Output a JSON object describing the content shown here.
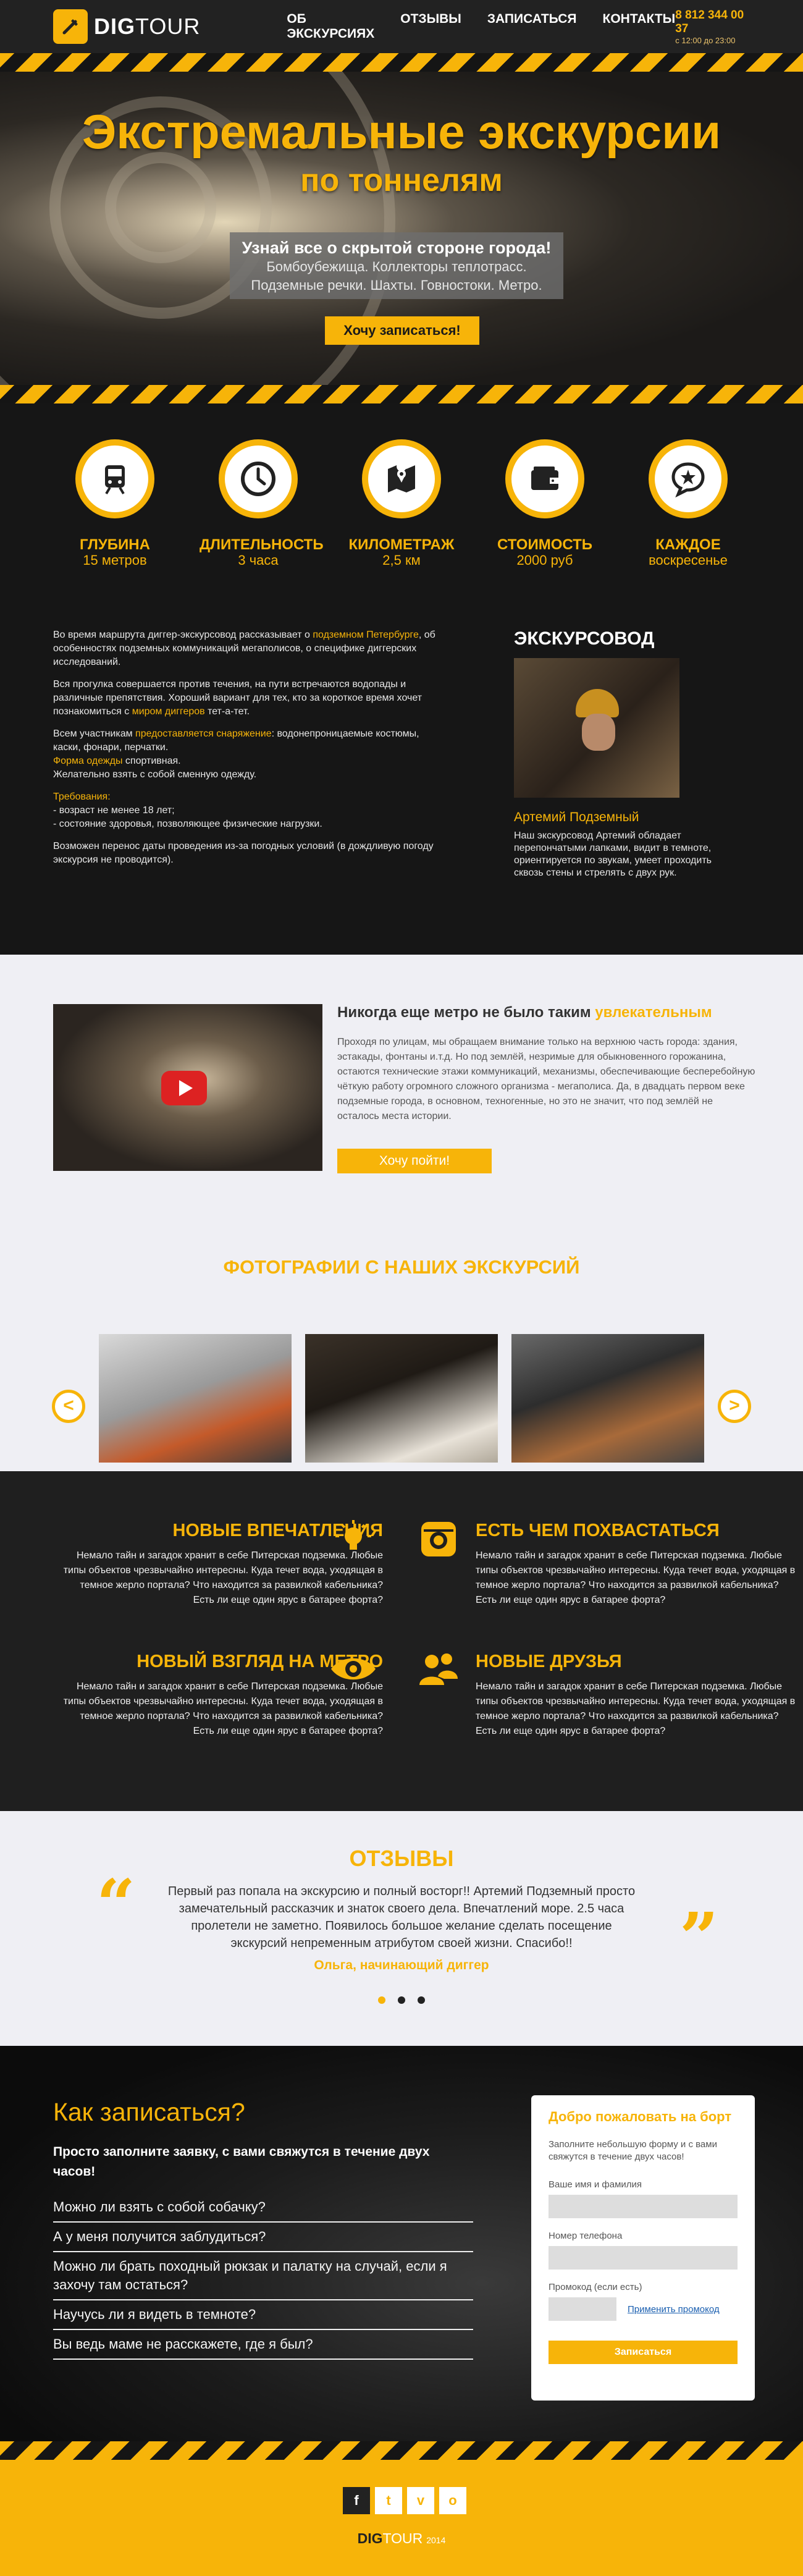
{
  "brand": {
    "logo_word_dig": "DIG",
    "logo_word_tour": "TOUR",
    "accent": "#f7b409"
  },
  "nav": [
    "ОБ ЭКСКУРСИЯХ",
    "ОТЗЫВЫ",
    "ЗАПИСАТЬСЯ",
    "КОНТАКТЫ"
  ],
  "contact": {
    "phone": "8 812 344 00 37",
    "hours": "с 12:00 до 23:00"
  },
  "hero": {
    "title": "Экстремальные экскурсии",
    "subtitle": "по тоннелям",
    "lead": "Узнай все о скрытой стороне города!",
    "line1": "Бомбоубежища. Коллекторы теплотрасс.",
    "line2": "Подземные речки. Шахты. Говностоки. Метро.",
    "cta": "Хочу записаться!"
  },
  "stats": [
    {
      "icon": "metro-icon",
      "title": "ГЛУБИНА",
      "value": "15 метров"
    },
    {
      "icon": "clock-icon",
      "title": "ДЛИТЕЛЬНОСТЬ",
      "value": "3 часа"
    },
    {
      "icon": "map-pin-icon",
      "title": "КИЛОМЕТРАЖ",
      "value": "2,5 км"
    },
    {
      "icon": "wallet-icon",
      "title": "СТОИМОСТЬ",
      "value": "2000 руб"
    },
    {
      "icon": "star-chat-icon",
      "title": "КАЖДОЕ",
      "value": "воскресенье"
    }
  ],
  "info": {
    "p1_a": "Во время маршрута диггер-экскурсовод рассказывает о ",
    "p1_hl": "подземном Петербурге",
    "p1_b": ", об особенностях подземных коммуникаций мегаполисов, о специфике диггерских исследований.",
    "p2_a": "Вся прогулка совершается против течения, на пути встречаются водопады и различные препятствия. Хороший вариант для тех, кто за короткое время хочет познакомиться с ",
    "p2_hl": "миром диггеров",
    "p2_b": " тет-а-тет.",
    "p3_a": "Всем участникам ",
    "p3_hl": "предоставляется снаряжение",
    "p3_b": ": водонепроницаемые костюмы, каски, фонари, перчатки.",
    "p3_c_hl": "Форма одежды",
    "p3_c": " спортивная.",
    "p3_d": "Желательно взять с собой сменную одежду.",
    "req_title": "Требования:",
    "req1": "- возраст не менее 18 лет;",
    "req2": "- состояние здоровья, позволяющее физические нагрузки.",
    "p4": "Возможен перенос даты проведения из-за погодных условий (в дождливую погоду экскурсия не проводится).",
    "guide_heading": "ЭКСКУРСОВОД",
    "guide_name": "Артемий Подземный",
    "guide_desc": "Наш экскурсовод Артемий обладает перепончатыми лапками, видит в темноте, ориентируется по звукам, умеет проходить сквозь стены и стрелять с двух рук."
  },
  "video": {
    "heading_a": "Никогда еще метро не было таким ",
    "heading_hl": "увлекательным",
    "text": "Проходя по улицам, мы обращаем внимание только на верхнюю часть города: здания, эстакады, фонтаны и.т.д. Но под землёй, незримые для обыкновенного горожанина, остаются технические этажи коммуникаций, механизмы, обеспечивающие бесперебойную чёткую работу огромного сложного организма - мегаполиса. Да, в двадцать первом веке подземные города, в основном, техногенные, но это не значит, что под землёй не осталось места истории.",
    "button": "Хочу пойти!"
  },
  "gallery": {
    "title": "ФОТОГРАФИИ С НАШИХ ЭКСКУРСИЙ",
    "prev": "<",
    "next": ">"
  },
  "features": [
    {
      "title": "НОВЫЕ ВПЕЧАТЛЕНИЯ",
      "icon": "lightbulb-icon",
      "text": "Немало тайн и загадок хранит в себе Питерская подземка. Любые типы объектов чрезвычайно интересны. Куда течет вода, уходящая в темное жерло портала? Что находится за развилкой кабельника? Есть ли еще один ярус в батарее форта?"
    },
    {
      "title": "ЕСТЬ ЧЕМ ПОХВАСТАТЬСЯ",
      "icon": "camera-icon",
      "text": "Немало тайн и загадок хранит в себе Питерская подземка. Любые типы объектов чрезвычайно интересны. Куда течет вода, уходящая в темное жерло портала? Что находится за развилкой кабельника? Есть ли еще один ярус в батарее форта?"
    },
    {
      "title": "НОВЫЙ ВЗГЛЯД НА МЕТРО",
      "icon": "eye-icon",
      "text": "Немало тайн и загадок хранит в себе Питерская подземка. Любые типы объектов чрезвычайно интересны. Куда течет вода, уходящая в темное жерло портала? Что находится за развилкой кабельника? Есть ли еще один ярус в батарее форта?"
    },
    {
      "title": "НОВЫЕ ДРУЗЬЯ",
      "icon": "friends-icon",
      "text": "Немало тайн и загадок хранит в себе Питерская подземка. Любые типы объектов чрезвычайно интересны. Куда течет вода, уходящая в темное жерло портала? Что находится за развилкой кабельника? Есть ли еще один ярус в батарее форта?"
    }
  ],
  "reviews": {
    "title": "ОТЗЫВЫ",
    "text": "Первый раз попала на экскурсию и полный восторг!! Артемий Подземный просто замечательный рассказчик и знаток своего дела. Впечатлений море. 2.5 часа пролетели не заметно. Появилось большое желание сделать посещение экскурсий непременным атрибутом своей жизни. Спасибо!!",
    "author": "Ольга, начинающий диггер",
    "open_quote": "“",
    "close_quote": "”"
  },
  "signup": {
    "title": "Как записаться?",
    "lead": "Просто заполните заявку, с вами свяжутся в течение двух часов!",
    "faq": [
      "Можно ли взять с собой собачку?",
      "А у меня получится заблудиться?",
      "Можно ли брать походный рюкзак и палатку на случай, если я захочу там остаться?",
      "Научусь ли я видеть в темноте?",
      "Вы ведь маме не расскажете, где я был?"
    ],
    "card_title": "Добро пожаловать на борт",
    "card_hint": "Заполните небольшую форму и с вами свяжутся в течение двух часов!",
    "name_label": "Ваше имя и фамилия",
    "phone_label": "Номер телефона",
    "promo_label": "Промокод (если есть)",
    "promo_link": "Применить промокод",
    "submit": "Записаться"
  },
  "footer": {
    "social": [
      "f",
      "t",
      "v",
      "o"
    ],
    "brand_dig": "DIG",
    "brand_tour": "TOUR",
    "year": "2014"
  }
}
